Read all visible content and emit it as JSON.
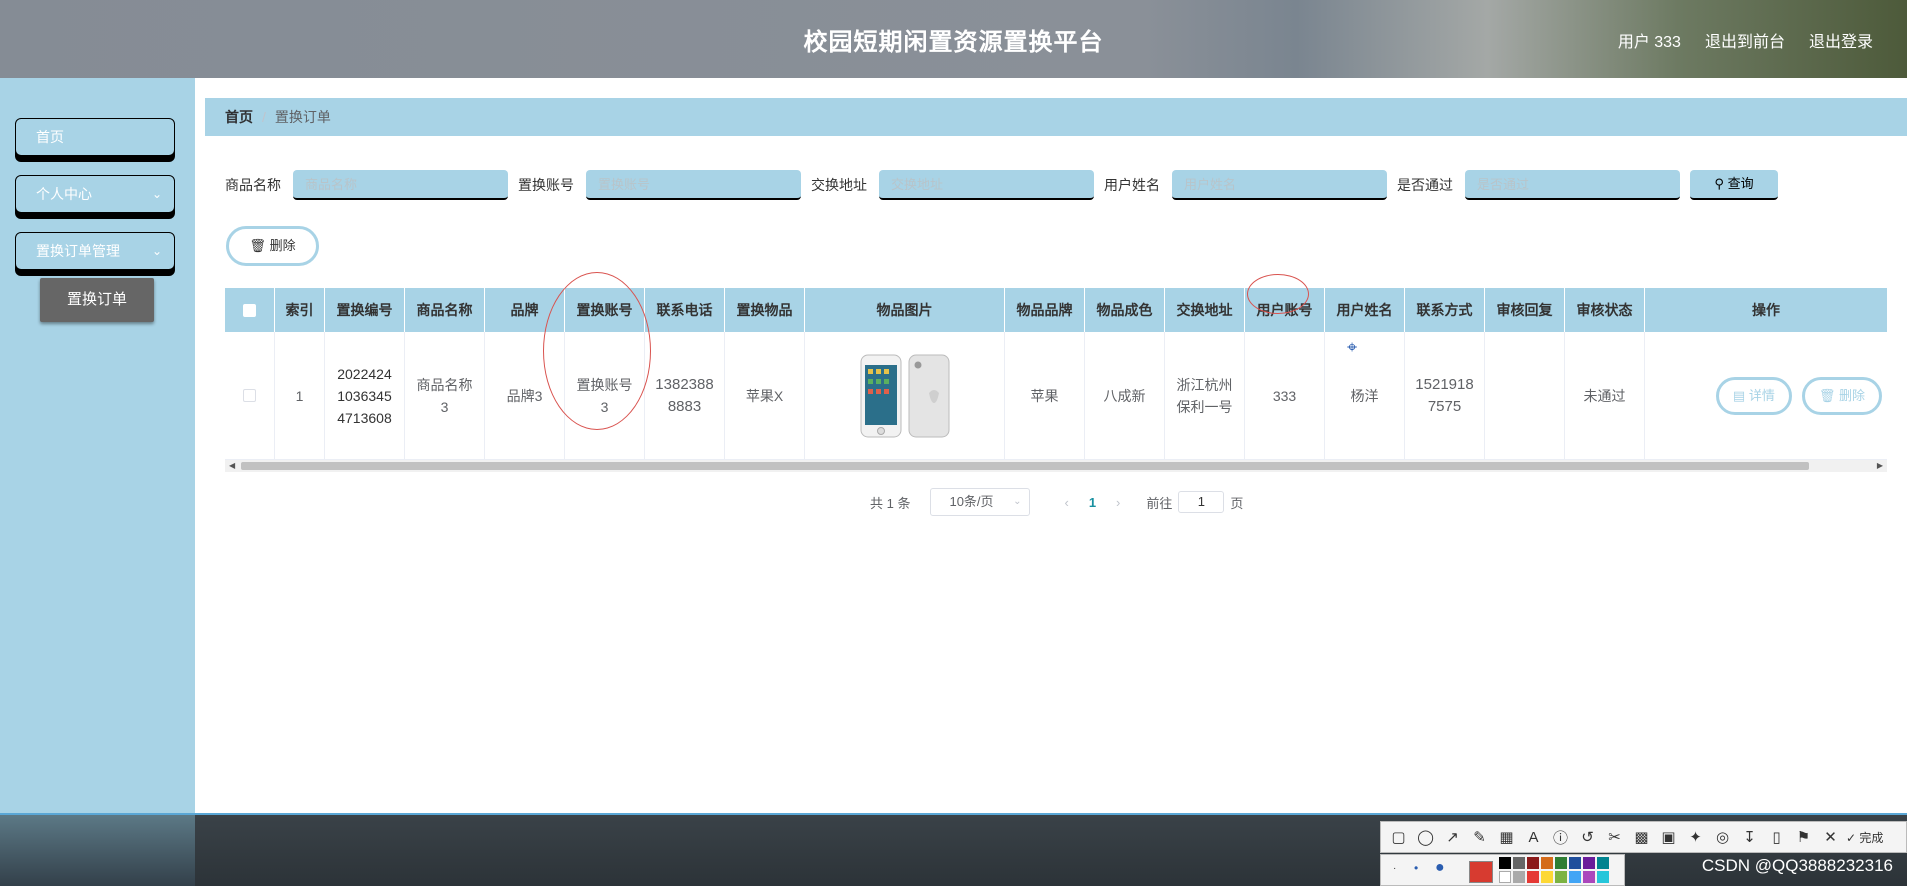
{
  "header": {
    "title": "校园短期闲置资源置换平台",
    "user": "用户 333",
    "back_front": "退出到前台",
    "logout": "退出登录"
  },
  "sidebar": {
    "items": [
      {
        "label": "首页"
      },
      {
        "label": "个人中心"
      },
      {
        "label": "置换订单管理"
      }
    ],
    "subitem": "置换订单"
  },
  "breadcrumb": {
    "home": "首页",
    "sep": "/",
    "current": "置换订单"
  },
  "search": {
    "fields": [
      {
        "label": "商品名称",
        "placeholder": "商品名称"
      },
      {
        "label": "置换账号",
        "placeholder": "置换账号"
      },
      {
        "label": "交换地址",
        "placeholder": "交换地址"
      },
      {
        "label": "用户姓名",
        "placeholder": "用户姓名"
      },
      {
        "label": "是否通过",
        "placeholder": "是否通过"
      }
    ],
    "query_button": "查询",
    "search_icon": "search-icon"
  },
  "actions": {
    "delete": "删除"
  },
  "table": {
    "headers": [
      "索引",
      "置换编号",
      "商品名称",
      "品牌",
      "置换账号",
      "联系电话",
      "置换物品",
      "物品图片",
      "物品品牌",
      "物品成色",
      "交换地址",
      "用户账号",
      "用户姓名",
      "联系方式",
      "审核回复",
      "审核状态",
      "操作"
    ],
    "rows": [
      {
        "index": "1",
        "order_no": "20224241036345 4713608",
        "order_no_lines": [
          "2022424",
          "1036345",
          "4713608"
        ],
        "product_name_lines": [
          "商品名称",
          "3"
        ],
        "brand": "品牌3",
        "account_lines": [
          "置换账号",
          "3"
        ],
        "phone_lines": [
          "1382388",
          "8883"
        ],
        "item": "苹果X",
        "item_brand": "苹果",
        "condition": "八成新",
        "address_lines": [
          "浙江杭州",
          "保利一号"
        ],
        "user_account": "333",
        "user_name": "杨洋",
        "contact_lines": [
          "1521918",
          "7575"
        ],
        "reply": "",
        "status": "未通过",
        "btn_detail": "详情",
        "btn_delete": "删除"
      }
    ]
  },
  "pagination": {
    "total": "共 1 条",
    "page_size": "10条/页",
    "current": "1",
    "goto_label": "前往",
    "goto_value": "1",
    "page_suffix": "页"
  },
  "overlay": {
    "watermark": "CSDN @QQ3888232316",
    "done": "完成"
  },
  "colors": {
    "accent": "#a8d3e6",
    "annotation": "#d9534f"
  }
}
